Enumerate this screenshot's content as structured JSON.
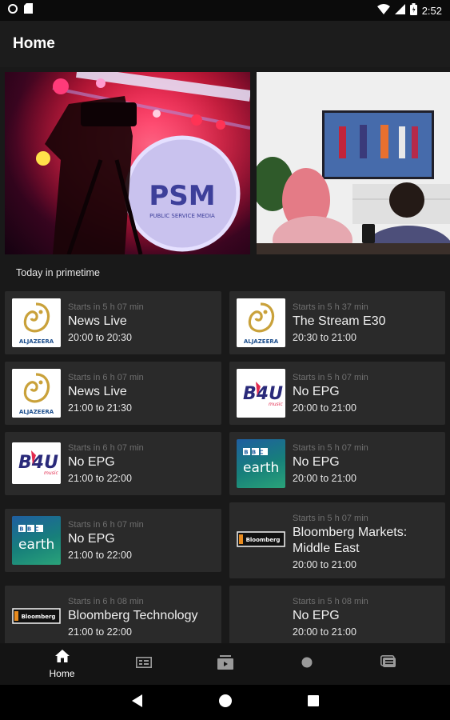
{
  "status": {
    "time": "2:52"
  },
  "app": {
    "title": "Home"
  },
  "hero": {
    "left_image_label": "PSM",
    "left_image_sublabel": "PUBLIC SERVICE MEDIA"
  },
  "section": {
    "title": "Today in primetime"
  },
  "cards": [
    {
      "logo": "aljazeera",
      "logo_text": "ALJAZEERA",
      "starts": "Starts in 5 h 07 min",
      "title": "News Live",
      "time": "20:00 to 20:30"
    },
    {
      "logo": "aljazeera",
      "logo_text": "ALJAZEERA",
      "starts": "Starts in 5 h 37 min",
      "title": "The Stream E30",
      "time": "20:30 to 21:00"
    },
    {
      "logo": "aljazeera",
      "logo_text": "ALJAZEERA",
      "starts": "Starts in 6 h 07 min",
      "title": "News Live",
      "time": "21:00 to 21:30"
    },
    {
      "logo": "b4u",
      "logo_text": "B4U",
      "logo_subtext": "music",
      "starts": "Starts in 5 h 07 min",
      "title": "No EPG",
      "time": "20:00 to 21:00"
    },
    {
      "logo": "b4u",
      "logo_text": "B4U",
      "logo_subtext": "music",
      "starts": "Starts in 6 h 07 min",
      "title": "No EPG",
      "time": "21:00 to 22:00"
    },
    {
      "logo": "bbcearth",
      "logo_text": "BBC",
      "logo_subtext": "earth",
      "starts": "Starts in 5 h 07 min",
      "title": "No EPG",
      "time": "20:00 to 21:00"
    },
    {
      "logo": "bbcearth",
      "logo_text": "BBC",
      "logo_subtext": "earth",
      "starts": "Starts in 6 h 07 min",
      "title": "No EPG",
      "time": "21:00 to 22:00"
    },
    {
      "logo": "bloomberg",
      "logo_text": "Bloomberg",
      "starts": "Starts in 5 h 07 min",
      "title": "Bloomberg Markets: Middle East",
      "time": "20:00 to 21:00"
    },
    {
      "logo": "bloomberg",
      "logo_text": "Bloomberg",
      "starts": "Starts in 6 h 08 min",
      "title": "Bloomberg Technology",
      "time": "21:00 to 22:00"
    },
    {
      "logo": "none",
      "starts": "Starts in 5 h 08 min",
      "title": "No EPG",
      "time": "20:00 to 21:00"
    }
  ],
  "bottom_nav": [
    {
      "icon": "home-icon",
      "label": "Home",
      "active": true
    },
    {
      "icon": "guide-icon",
      "label": "",
      "active": false
    },
    {
      "icon": "recordings-icon",
      "label": "",
      "active": false
    },
    {
      "icon": "record-dot-icon",
      "label": "",
      "active": false
    },
    {
      "icon": "messages-icon",
      "label": "",
      "active": false
    }
  ]
}
